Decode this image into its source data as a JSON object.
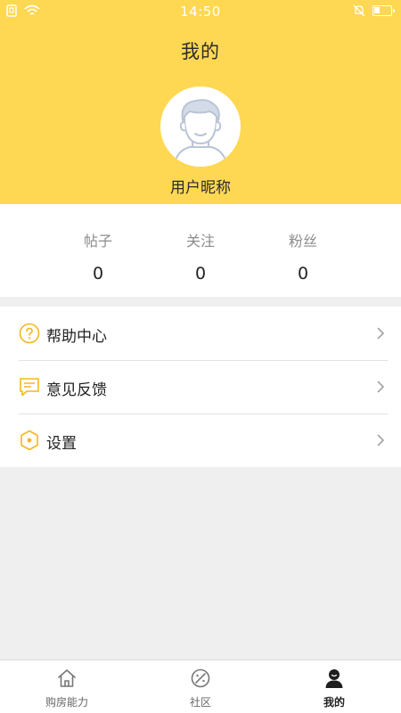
{
  "status_bar": {
    "time": "14:50"
  },
  "header": {
    "title": "我的",
    "nickname": "用户昵称"
  },
  "stats": [
    {
      "label": "帖子",
      "value": "0"
    },
    {
      "label": "关注",
      "value": "0"
    },
    {
      "label": "粉丝",
      "value": "0"
    }
  ],
  "menu": [
    {
      "label": "帮助中心",
      "icon": "help-circle-icon"
    },
    {
      "label": "意见反馈",
      "icon": "feedback-chat-icon"
    },
    {
      "label": "设置",
      "icon": "settings-hexagon-icon"
    }
  ],
  "tabs": [
    {
      "label": "购房能力",
      "icon": "home-icon",
      "active": false
    },
    {
      "label": "社区",
      "icon": "planet-icon",
      "active": false
    },
    {
      "label": "我的",
      "icon": "user-icon",
      "active": true
    }
  ],
  "colors": {
    "header_bg": "#fed853",
    "icon_accent": "#f5b71c",
    "page_bg": "#efefef"
  }
}
